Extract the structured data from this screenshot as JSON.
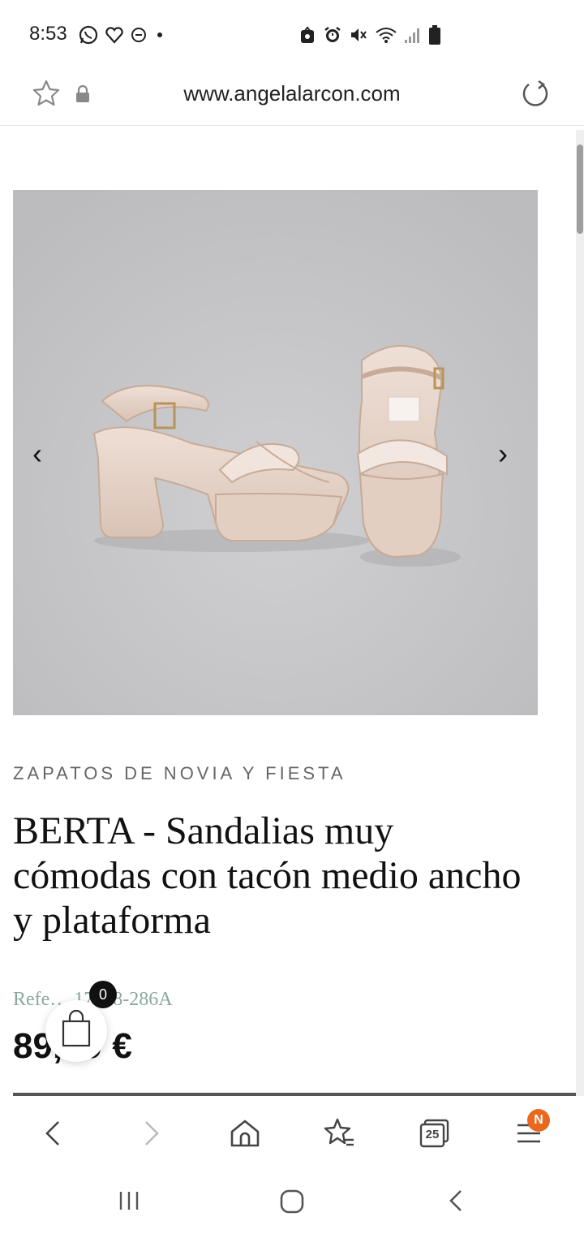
{
  "status_bar": {
    "time": "8:53",
    "left_icons": [
      "whatsapp-icon",
      "heart-icon",
      "minus-circle-icon",
      "dot-icon"
    ],
    "right_icons": [
      "sync-icon",
      "alarm-icon",
      "mute-icon",
      "wifi-icon",
      "signal-icon",
      "battery-icon"
    ]
  },
  "url_bar": {
    "url": "www.angelalarcon.com"
  },
  "product": {
    "category": "ZAPATOS DE NOVIA Y FIESTA",
    "title": "BERTA - Sandalias muy cómodas con tacón medio ancho y plataforma",
    "reference": "Refe… 17598-286A",
    "price": "89,99 €",
    "prev_arrow": "‹",
    "next_arrow": "›"
  },
  "cart": {
    "count": "0"
  },
  "toolbar": {
    "tabs_count": "25",
    "menu_badge": "N"
  },
  "colors": {
    "image_bg": "#c4c4c6",
    "accent_badge": "#e8681e",
    "reference_text": "#8aa8a0"
  }
}
